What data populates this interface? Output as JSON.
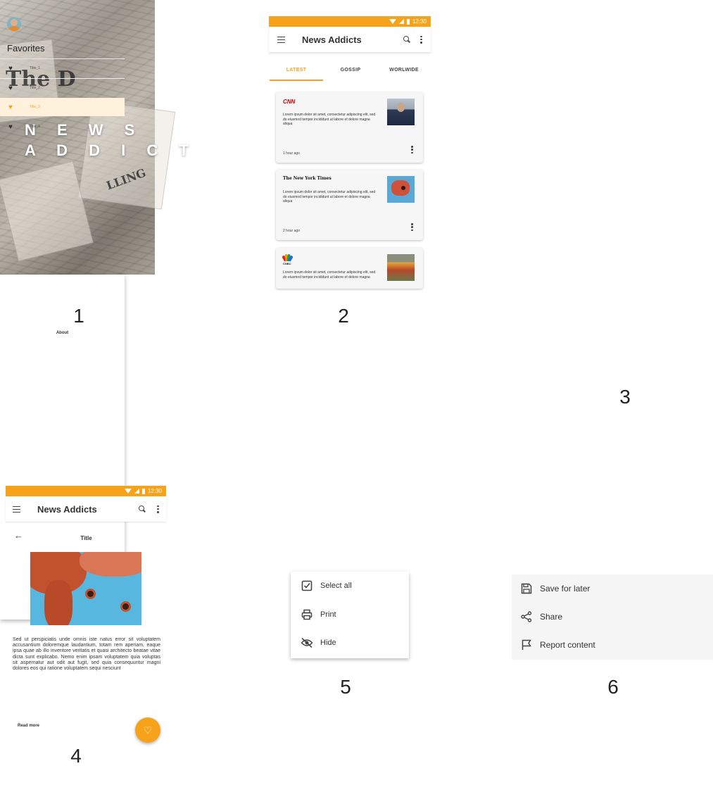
{
  "colors": {
    "accent": "#f7a21b",
    "accent_light": "#fff1dc",
    "card_bg": "#f6f6f6",
    "text": "#333333"
  },
  "labels": [
    "1",
    "2",
    "3",
    "4",
    "5",
    "6"
  ],
  "splash": {
    "brand_line1": "N E W S",
    "brand_line2": "A D D I C T"
  },
  "status_bar": {
    "time": "12:30"
  },
  "feed": {
    "app_title": "News Addicts",
    "tabs": [
      {
        "label": "LATEST",
        "active": true
      },
      {
        "label": "GOSSIP",
        "active": false
      },
      {
        "label": "WORLWIDE",
        "active": false
      }
    ],
    "articles": [
      {
        "source": "CNN",
        "excerpt": "Lorem ipsum dolor sit amet, consectetur adipiscing elit, sed do eiusmod tempor incididunt ut labore et dolore magna aliqua",
        "time": "1 hour ago"
      },
      {
        "source": "The New York Times",
        "excerpt": "Lorem ipsum dolor sit amet, consectetur adipiscing elit, sed do eiusmod tempor incididunt ut labore et dolore magna aliqua",
        "time": "2 hour ago"
      },
      {
        "source": "CNBC",
        "excerpt": "Lorem ipsum dolor sit amet, consectetur adipiscing elit, sed do eiusmod tempor incididunt ut labore et dolore magna",
        "time": ""
      }
    ]
  },
  "drawer": {
    "heading": "Favorites",
    "items": [
      {
        "title": "Title_1",
        "selected": false
      },
      {
        "title": "Title_2",
        "selected": false
      },
      {
        "title": "Title_3",
        "selected": true
      },
      {
        "title": "Title_4",
        "selected": false
      }
    ],
    "footer": "About"
  },
  "detail": {
    "app_title": "News Addicts",
    "page_title": "Title",
    "body": "Sed ut perspiciatis unde omnis iste natus error sit voluptatem accusantium doloremque laudantium, totam rem aperiam, eaque ipsa quae ab illo inventore veritatis et quasi architecto beatae vitae dicta sunt explicabo. Nemo enim ipsam voluptatem quia voluptas sit aspernatur aut odit aut fugit, sed quia consequuntur magni dolores eos qui ratione voluptatem sequi nesciunt",
    "read_more": "Read more"
  },
  "context_menu": {
    "items": [
      {
        "label": "Select all",
        "icon": "checkbox-icon"
      },
      {
        "label": "Print",
        "icon": "print-icon"
      },
      {
        "label": "Hide",
        "icon": "eye-off-icon"
      }
    ]
  },
  "share_menu": {
    "items": [
      {
        "label": "Save for later",
        "icon": "save-icon"
      },
      {
        "label": "Share",
        "icon": "share-icon"
      },
      {
        "label": "Report content",
        "icon": "flag-icon"
      }
    ]
  }
}
